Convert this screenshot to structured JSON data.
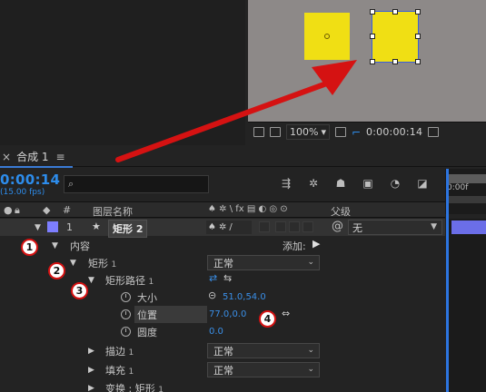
{
  "viewer": {
    "zoom_label": "100%",
    "timecode": "0:00:00:14"
  },
  "comp_tab": {
    "close_glyph": "×",
    "title": "合成 1",
    "menu_glyph": "≡"
  },
  "timeline": {
    "current_time": "0:00:14",
    "fps": "(15.00 fps)",
    "search_icon_glyph": "⌕",
    "ruler_label": "0:00f"
  },
  "columns": {
    "hash": "#",
    "layer_name": "图层名称",
    "switches": "♠ ✲ \\ fx ▤ ◐ ◎ ⊙",
    "parent": "父级"
  },
  "layer": {
    "number": "1",
    "name": "矩形 2",
    "parent_value": "无",
    "swatch_color": "#7d7eff"
  },
  "properties": {
    "contents_label": "内容",
    "add_label": "添加:",
    "rect_label": "矩形",
    "rect_index": "1",
    "rect_mode": "正常",
    "rect_path_label": "矩形路径",
    "rect_path_index": "1",
    "size_label": "大小",
    "size_value": "51.0,54.0",
    "position_label": "位置",
    "position_value": "77.0,0.0",
    "roundness_label": "圆度",
    "roundness_value": "0.0",
    "stroke_label": "描边",
    "stroke_index": "1",
    "stroke_mode": "正常",
    "fill_label": "填充",
    "fill_index": "1",
    "fill_mode": "正常",
    "transform_label": "变换 : 矩形",
    "transform_index": "1"
  },
  "callouts": [
    "1",
    "2",
    "3",
    "4"
  ],
  "colors": {
    "accent_blue": "#2d8ceb",
    "shape_yellow": "#f0df14",
    "callout_red": "#d51212"
  }
}
